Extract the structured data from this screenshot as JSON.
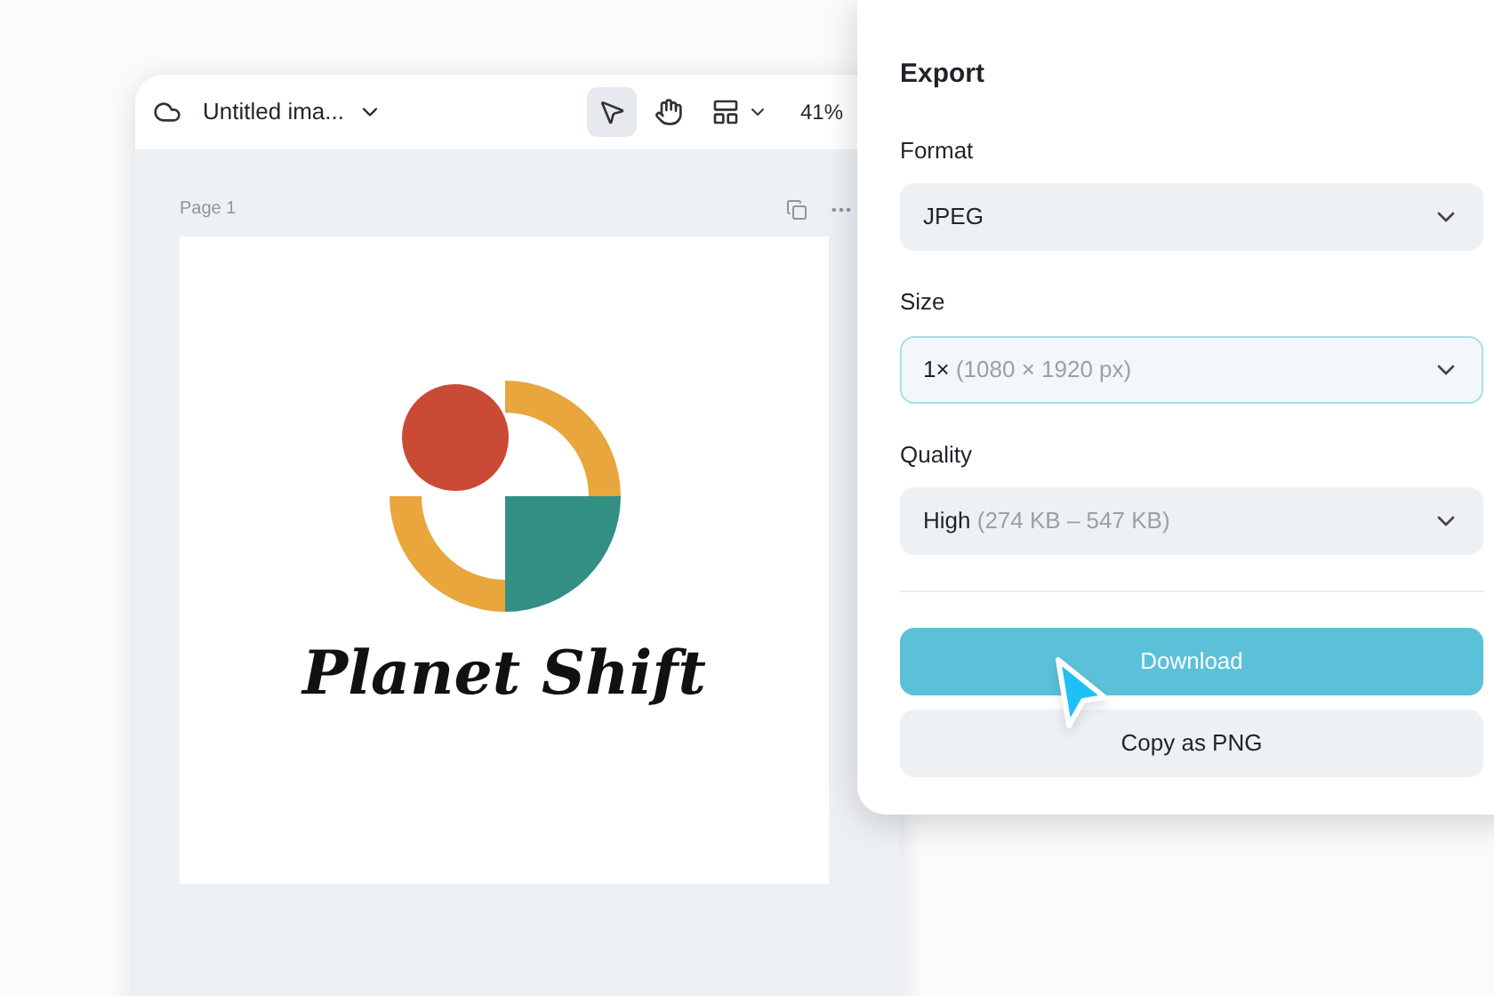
{
  "editor": {
    "doc_title": "Untitled ima...",
    "tools": [
      {
        "kind": "select",
        "selected": true
      },
      {
        "kind": "hand",
        "selected": false
      },
      {
        "kind": "layout",
        "selected": false
      }
    ],
    "zoom": "41%",
    "page_label": "Page 1",
    "design": {
      "brand_name": "Planet Shift"
    }
  },
  "export": {
    "title": "Export",
    "fields": [
      {
        "label": "Format",
        "value": "JPEG",
        "focused": false
      },
      {
        "label": "Size",
        "value": "1×",
        "detail": "(1080 × 1920 px)",
        "focused": true
      },
      {
        "label": "Quality",
        "value": "High",
        "detail": "(274 KB – 547 KB)",
        "focused": false
      }
    ],
    "buttons": [
      {
        "label": "Download",
        "kind": "primary"
      },
      {
        "label": "Copy as PNG",
        "kind": "secondary"
      }
    ]
  }
}
